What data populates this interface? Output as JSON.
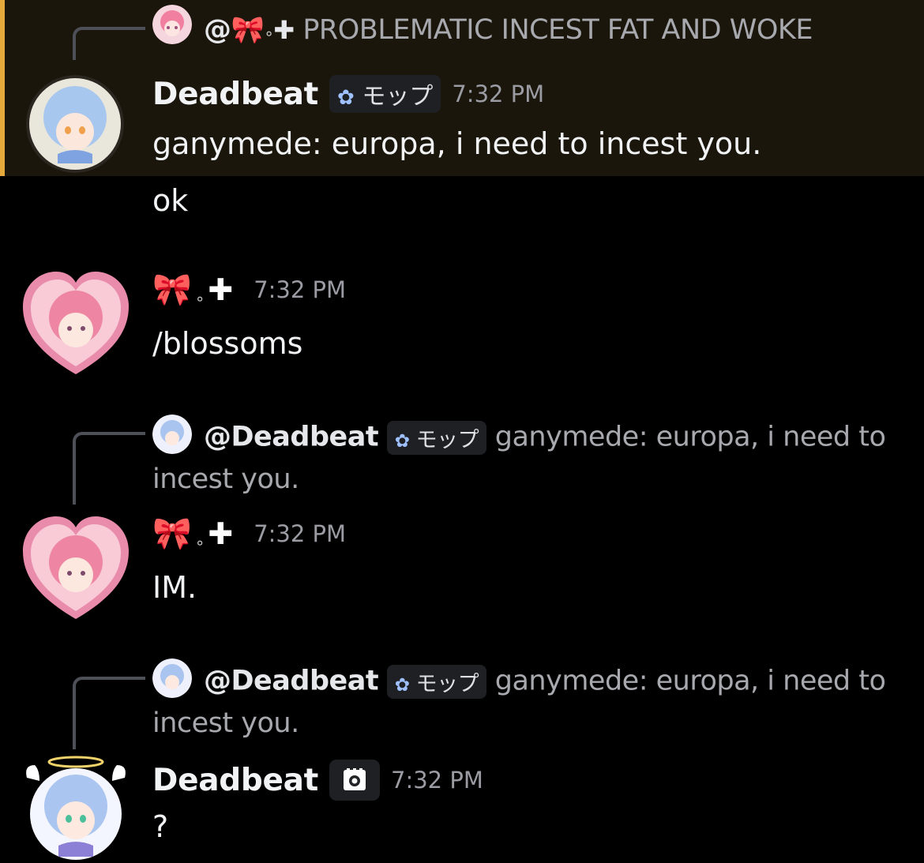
{
  "highlighted_message": {
    "reply": {
      "mention": "@",
      "ribbon": "🎀",
      "ring": "∘",
      "plus": "✚",
      "text": "PROBLEMATIC INCEST FAT AND WOKE"
    },
    "author": "Deadbeat",
    "role_tag": "モップ",
    "time": "7:32 PM",
    "text": "ganymede: europa, i need to incest you."
  },
  "followup_message": {
    "text": "ok"
  },
  "message_2": {
    "author_ribbon": "🎀",
    "author_ring": "∘",
    "author_plus": "✚",
    "time": "7:32 PM",
    "text": "/blossoms"
  },
  "message_3": {
    "reply": {
      "name": "@Deadbeat",
      "role_tag": "モップ",
      "text_line1": "ganymede: europa, i need to",
      "text_line2": "incest you."
    },
    "author_ribbon": "🎀",
    "author_ring": "∘",
    "author_plus": "✚",
    "time": "7:32 PM",
    "text": "IM."
  },
  "message_4": {
    "reply": {
      "name": "@Deadbeat",
      "role_tag": "モップ",
      "text_line1": "ganymede: europa, i need to",
      "text_line2": "incest you."
    },
    "author": "Deadbeat",
    "time": "7:32 PM",
    "text": "?"
  },
  "colors": {
    "background": "#000000",
    "highlight_background": "#1a160c",
    "highlight_bar": "#e5a83b",
    "muted_text": "#a7a9ae",
    "timestamp": "#9b9ca3"
  }
}
